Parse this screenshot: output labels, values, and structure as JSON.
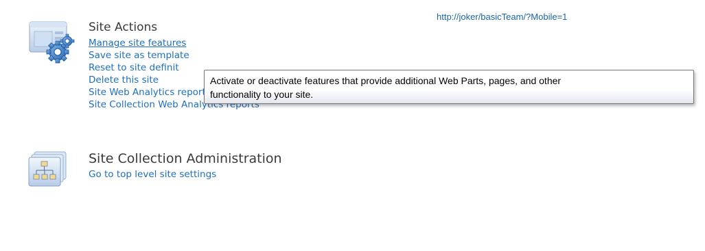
{
  "url": "http://joker/basicTeam/?Mobile=1",
  "site_actions": {
    "icon": "site-actions-gear-window-icon",
    "title": "Site Actions",
    "links": [
      "Manage site features",
      "Save site as template",
      "Reset to site definit",
      "Delete this site",
      "Site Web Analytics reports",
      "Site Collection Web Analytics reports"
    ]
  },
  "site_collection_admin": {
    "icon": "site-collection-hierarchy-icon",
    "title": "Site Collection Administration",
    "links": [
      "Go to top level site settings"
    ]
  },
  "tooltip": {
    "line1": "Activate or deactivate features that provide additional Web Parts, pages, and other",
    "line2": "functionality to your site."
  },
  "colors": {
    "link": "#1d6fc0",
    "url": "#1b64a8",
    "title": "#3a3a3a"
  }
}
